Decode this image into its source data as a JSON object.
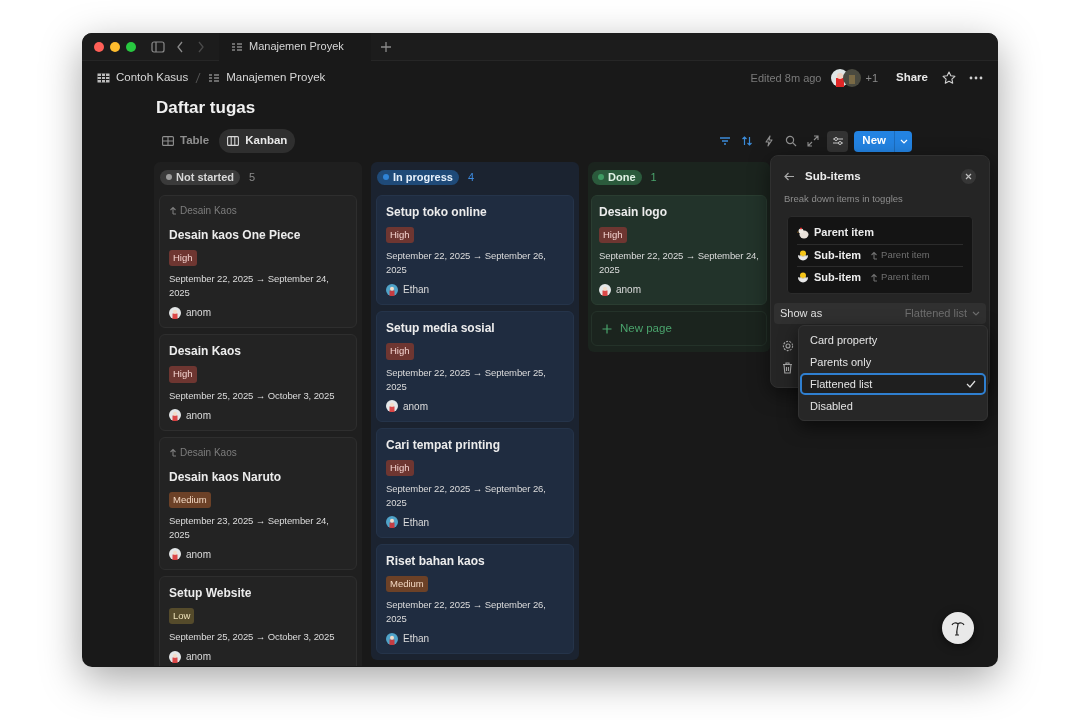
{
  "tab": {
    "title": "Manajemen Proyek"
  },
  "breadcrumb": [
    "Contoh Kasus",
    "Manajemen Proyek"
  ],
  "header": {
    "edited": "Edited 8m ago",
    "more_people": "+1",
    "share": "Share"
  },
  "page_title": "Daftar tugas",
  "views": [
    {
      "label": "Table",
      "kind": "table",
      "selected": false
    },
    {
      "label": "Kanban",
      "kind": "board",
      "selected": true
    }
  ],
  "new_button": "New",
  "columns": [
    {
      "name": "Not started",
      "count": "5",
      "color": "#9b9b9b",
      "kind": "gray",
      "cards": [
        {
          "parent": "Desain Kaos",
          "title": "Desain kaos One Piece",
          "priority": {
            "label": "High",
            "kind": "high"
          },
          "dates": "September 22, 2025 → September 24, 2025",
          "assignee": {
            "name": "anom",
            "color": "#e4e7e8"
          }
        },
        {
          "title": "Desain Kaos",
          "priority": {
            "label": "High",
            "kind": "high"
          },
          "dates": "September 25, 2025 → October 3, 2025",
          "assignee": {
            "name": "anom",
            "color": "#e4e7e8"
          }
        },
        {
          "parent": "Desain Kaos",
          "title": "Desain kaos Naruto",
          "priority": {
            "label": "Medium",
            "kind": "medium"
          },
          "dates": "September 23, 2025 → September 24, 2025",
          "assignee": {
            "name": "anom",
            "color": "#e4e7e8"
          }
        },
        {
          "title": "Setup Website",
          "priority": {
            "label": "Low",
            "kind": "low"
          },
          "dates": "September 25, 2025 → October 3, 2025",
          "assignee": {
            "name": "anom",
            "color": "#e4e7e8"
          }
        }
      ]
    },
    {
      "name": "In progress",
      "count": "4",
      "color": "#2f83d6",
      "kind": "blue",
      "cards": [
        {
          "title": "Setup toko online",
          "priority": {
            "label": "High",
            "kind": "high"
          },
          "dates": "September 22, 2025 → September 26, 2025",
          "assignee": {
            "name": "Ethan",
            "color": "#4fa3c9"
          }
        },
        {
          "title": "Setup media sosial",
          "priority": {
            "label": "High",
            "kind": "high"
          },
          "dates": "September 22, 2025 → September 25, 2025",
          "assignee": {
            "name": "anom",
            "color": "#e4e7e8"
          }
        },
        {
          "title": "Cari tempat printing",
          "priority": {
            "label": "High",
            "kind": "high"
          },
          "dates": "September 22, 2025 → September 26, 2025",
          "assignee": {
            "name": "Ethan",
            "color": "#4fa3c9"
          }
        },
        {
          "title": "Riset bahan kaos",
          "priority": {
            "label": "Medium",
            "kind": "medium"
          },
          "dates": "September 22, 2025 → September 26, 2025",
          "assignee": {
            "name": "Ethan",
            "color": "#4fa3c9"
          }
        }
      ]
    },
    {
      "name": "Done",
      "count": "1",
      "color": "#3f9b63",
      "kind": "green",
      "new_page": "New page",
      "cards": [
        {
          "title": "Desain logo",
          "priority": {
            "label": "High",
            "kind": "high"
          },
          "dates": "September 22, 2025 → September 24, 2025",
          "assignee": {
            "name": "anom",
            "color": "#e4e7e8"
          }
        }
      ]
    }
  ],
  "panel": {
    "title": "Sub-items",
    "subtitle": "Break down items in toggles",
    "preview": [
      {
        "kind": "parent",
        "label": "Parent item"
      },
      {
        "kind": "sub",
        "label": "Sub-item",
        "parent": "Parent item"
      },
      {
        "kind": "sub",
        "label": "Sub-item",
        "parent": "Parent item"
      }
    ],
    "show_as": {
      "label": "Show as",
      "value": "Flattened list"
    },
    "options": [
      {
        "label": "Card property",
        "selected": false
      },
      {
        "label": "Parents only",
        "selected": false
      },
      {
        "label": "Flattened list",
        "selected": true
      },
      {
        "label": "Disabled",
        "selected": false
      }
    ]
  }
}
